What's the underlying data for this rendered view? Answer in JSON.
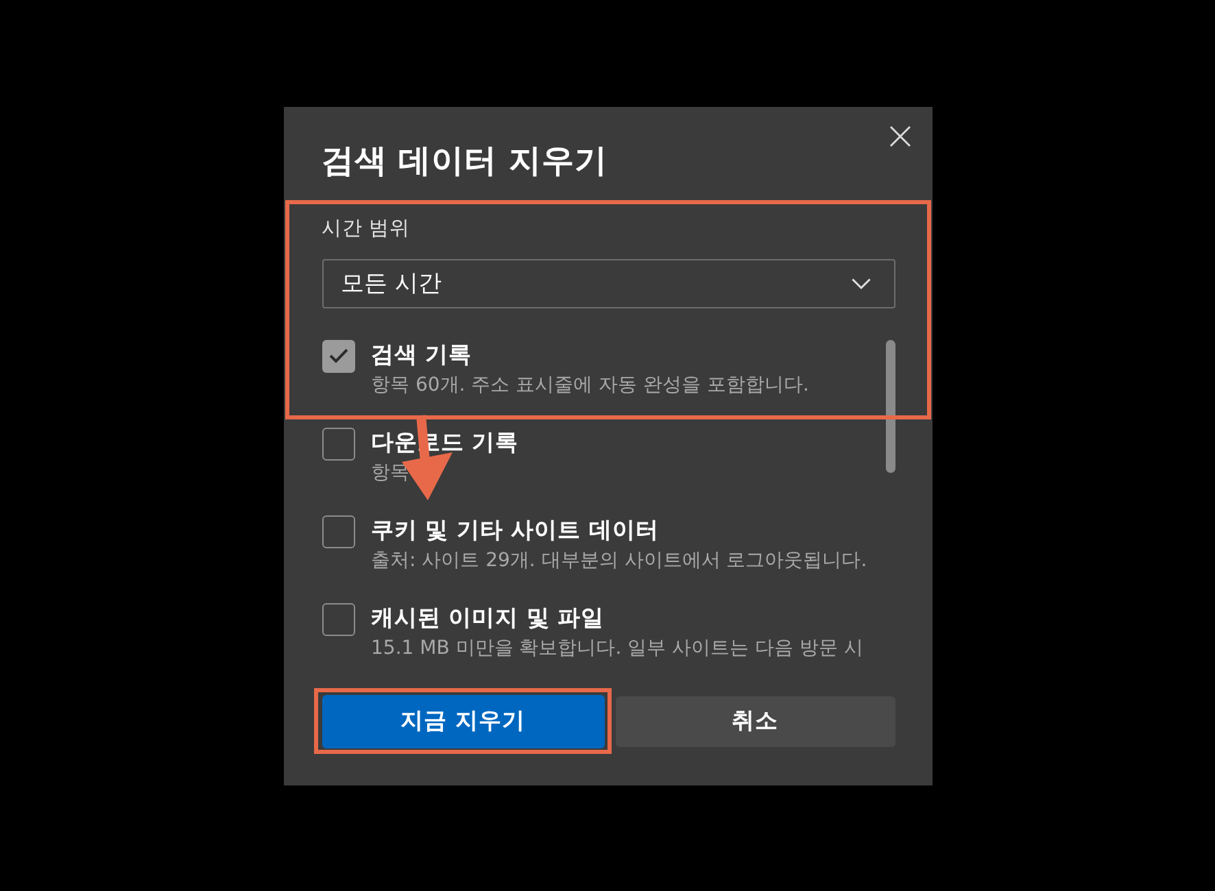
{
  "dialog": {
    "title": "검색 데이터 지우기",
    "time_range": {
      "label": "시간 범위",
      "value": "모든 시간"
    },
    "items": [
      {
        "title": "검색 기록",
        "description": "항목 60개. 주소 표시줄에 자동 완성을 포함합니다.",
        "checked": true
      },
      {
        "title": "다운로드 기록",
        "description": "항목",
        "checked": false
      },
      {
        "title": "쿠키 및 기타 사이트 데이터",
        "description": "출처: 사이트 29개. 대부분의 사이트에서 로그아웃됩니다.",
        "checked": false
      },
      {
        "title": "캐시된 이미지 및 파일",
        "description": "15.1 MB 미만을 확보합니다. 일부 사이트는 다음 방문 시",
        "checked": false
      }
    ],
    "buttons": [
      {
        "label": "지금 지우기",
        "kind": "primary"
      },
      {
        "label": "취소",
        "kind": "secondary"
      }
    ]
  },
  "annotations": [
    {
      "kind": "frame"
    },
    {
      "kind": "arrow"
    },
    {
      "kind": "frame"
    }
  ]
}
